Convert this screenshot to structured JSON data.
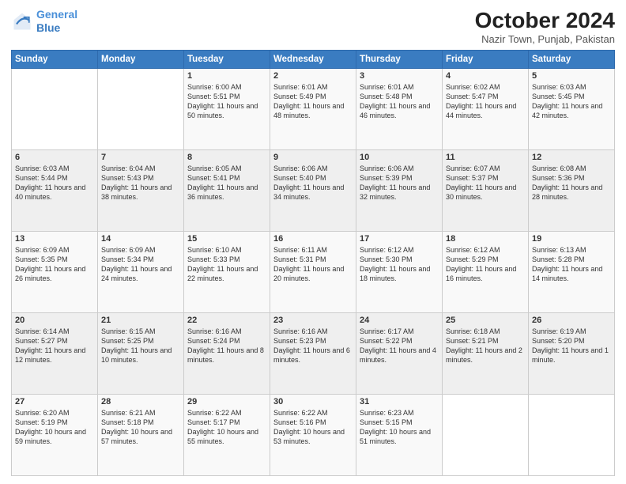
{
  "logo": {
    "line1": "General",
    "line2": "Blue"
  },
  "title": "October 2024",
  "subtitle": "Nazir Town, Punjab, Pakistan",
  "days_of_week": [
    "Sunday",
    "Monday",
    "Tuesday",
    "Wednesday",
    "Thursday",
    "Friday",
    "Saturday"
  ],
  "weeks": [
    [
      {
        "day": "",
        "sunrise": "",
        "sunset": "",
        "daylight": ""
      },
      {
        "day": "",
        "sunrise": "",
        "sunset": "",
        "daylight": ""
      },
      {
        "day": "1",
        "sunrise": "Sunrise: 6:00 AM",
        "sunset": "Sunset: 5:51 PM",
        "daylight": "Daylight: 11 hours and 50 minutes."
      },
      {
        "day": "2",
        "sunrise": "Sunrise: 6:01 AM",
        "sunset": "Sunset: 5:49 PM",
        "daylight": "Daylight: 11 hours and 48 minutes."
      },
      {
        "day": "3",
        "sunrise": "Sunrise: 6:01 AM",
        "sunset": "Sunset: 5:48 PM",
        "daylight": "Daylight: 11 hours and 46 minutes."
      },
      {
        "day": "4",
        "sunrise": "Sunrise: 6:02 AM",
        "sunset": "Sunset: 5:47 PM",
        "daylight": "Daylight: 11 hours and 44 minutes."
      },
      {
        "day": "5",
        "sunrise": "Sunrise: 6:03 AM",
        "sunset": "Sunset: 5:45 PM",
        "daylight": "Daylight: 11 hours and 42 minutes."
      }
    ],
    [
      {
        "day": "6",
        "sunrise": "Sunrise: 6:03 AM",
        "sunset": "Sunset: 5:44 PM",
        "daylight": "Daylight: 11 hours and 40 minutes."
      },
      {
        "day": "7",
        "sunrise": "Sunrise: 6:04 AM",
        "sunset": "Sunset: 5:43 PM",
        "daylight": "Daylight: 11 hours and 38 minutes."
      },
      {
        "day": "8",
        "sunrise": "Sunrise: 6:05 AM",
        "sunset": "Sunset: 5:41 PM",
        "daylight": "Daylight: 11 hours and 36 minutes."
      },
      {
        "day": "9",
        "sunrise": "Sunrise: 6:06 AM",
        "sunset": "Sunset: 5:40 PM",
        "daylight": "Daylight: 11 hours and 34 minutes."
      },
      {
        "day": "10",
        "sunrise": "Sunrise: 6:06 AM",
        "sunset": "Sunset: 5:39 PM",
        "daylight": "Daylight: 11 hours and 32 minutes."
      },
      {
        "day": "11",
        "sunrise": "Sunrise: 6:07 AM",
        "sunset": "Sunset: 5:37 PM",
        "daylight": "Daylight: 11 hours and 30 minutes."
      },
      {
        "day": "12",
        "sunrise": "Sunrise: 6:08 AM",
        "sunset": "Sunset: 5:36 PM",
        "daylight": "Daylight: 11 hours and 28 minutes."
      }
    ],
    [
      {
        "day": "13",
        "sunrise": "Sunrise: 6:09 AM",
        "sunset": "Sunset: 5:35 PM",
        "daylight": "Daylight: 11 hours and 26 minutes."
      },
      {
        "day": "14",
        "sunrise": "Sunrise: 6:09 AM",
        "sunset": "Sunset: 5:34 PM",
        "daylight": "Daylight: 11 hours and 24 minutes."
      },
      {
        "day": "15",
        "sunrise": "Sunrise: 6:10 AM",
        "sunset": "Sunset: 5:33 PM",
        "daylight": "Daylight: 11 hours and 22 minutes."
      },
      {
        "day": "16",
        "sunrise": "Sunrise: 6:11 AM",
        "sunset": "Sunset: 5:31 PM",
        "daylight": "Daylight: 11 hours and 20 minutes."
      },
      {
        "day": "17",
        "sunrise": "Sunrise: 6:12 AM",
        "sunset": "Sunset: 5:30 PM",
        "daylight": "Daylight: 11 hours and 18 minutes."
      },
      {
        "day": "18",
        "sunrise": "Sunrise: 6:12 AM",
        "sunset": "Sunset: 5:29 PM",
        "daylight": "Daylight: 11 hours and 16 minutes."
      },
      {
        "day": "19",
        "sunrise": "Sunrise: 6:13 AM",
        "sunset": "Sunset: 5:28 PM",
        "daylight": "Daylight: 11 hours and 14 minutes."
      }
    ],
    [
      {
        "day": "20",
        "sunrise": "Sunrise: 6:14 AM",
        "sunset": "Sunset: 5:27 PM",
        "daylight": "Daylight: 11 hours and 12 minutes."
      },
      {
        "day": "21",
        "sunrise": "Sunrise: 6:15 AM",
        "sunset": "Sunset: 5:25 PM",
        "daylight": "Daylight: 11 hours and 10 minutes."
      },
      {
        "day": "22",
        "sunrise": "Sunrise: 6:16 AM",
        "sunset": "Sunset: 5:24 PM",
        "daylight": "Daylight: 11 hours and 8 minutes."
      },
      {
        "day": "23",
        "sunrise": "Sunrise: 6:16 AM",
        "sunset": "Sunset: 5:23 PM",
        "daylight": "Daylight: 11 hours and 6 minutes."
      },
      {
        "day": "24",
        "sunrise": "Sunrise: 6:17 AM",
        "sunset": "Sunset: 5:22 PM",
        "daylight": "Daylight: 11 hours and 4 minutes."
      },
      {
        "day": "25",
        "sunrise": "Sunrise: 6:18 AM",
        "sunset": "Sunset: 5:21 PM",
        "daylight": "Daylight: 11 hours and 2 minutes."
      },
      {
        "day": "26",
        "sunrise": "Sunrise: 6:19 AM",
        "sunset": "Sunset: 5:20 PM",
        "daylight": "Daylight: 11 hours and 1 minute."
      }
    ],
    [
      {
        "day": "27",
        "sunrise": "Sunrise: 6:20 AM",
        "sunset": "Sunset: 5:19 PM",
        "daylight": "Daylight: 10 hours and 59 minutes."
      },
      {
        "day": "28",
        "sunrise": "Sunrise: 6:21 AM",
        "sunset": "Sunset: 5:18 PM",
        "daylight": "Daylight: 10 hours and 57 minutes."
      },
      {
        "day": "29",
        "sunrise": "Sunrise: 6:22 AM",
        "sunset": "Sunset: 5:17 PM",
        "daylight": "Daylight: 10 hours and 55 minutes."
      },
      {
        "day": "30",
        "sunrise": "Sunrise: 6:22 AM",
        "sunset": "Sunset: 5:16 PM",
        "daylight": "Daylight: 10 hours and 53 minutes."
      },
      {
        "day": "31",
        "sunrise": "Sunrise: 6:23 AM",
        "sunset": "Sunset: 5:15 PM",
        "daylight": "Daylight: 10 hours and 51 minutes."
      },
      {
        "day": "",
        "sunrise": "",
        "sunset": "",
        "daylight": ""
      },
      {
        "day": "",
        "sunrise": "",
        "sunset": "",
        "daylight": ""
      }
    ]
  ]
}
